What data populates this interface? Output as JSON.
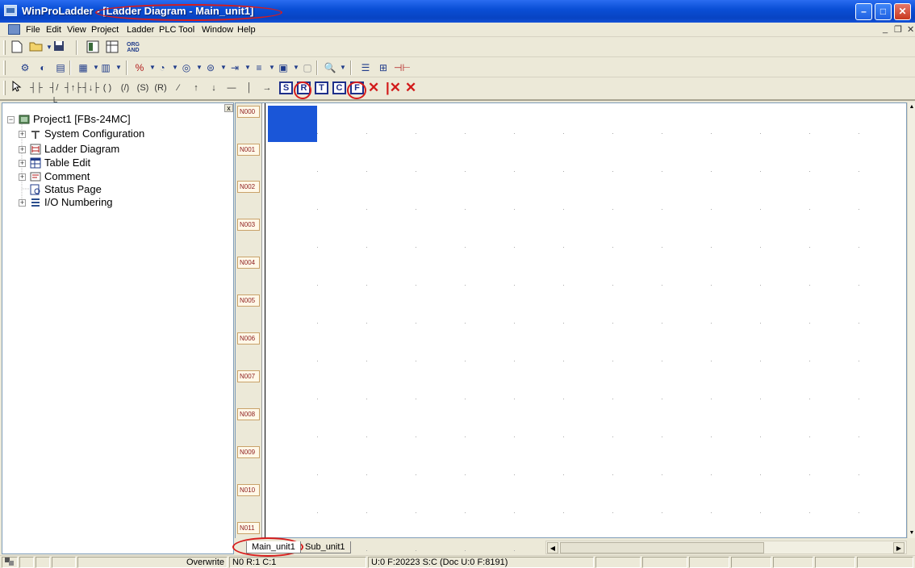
{
  "window": {
    "title_prefix": "WinProLadder",
    "title_sep": " - ",
    "title_doc": "[Ladder Diagram - Main_unit1]",
    "min_glyph": "–",
    "max_glyph": "□",
    "close_glyph": "✕"
  },
  "menu": {
    "items": [
      "File",
      "Edit",
      "View",
      "Project",
      "Ladder",
      "PLC",
      "Tool",
      "Window",
      "Help"
    ],
    "mdi_min": "_",
    "mdi_restore": "❐",
    "mdi_close": "✕"
  },
  "toolbar1": {
    "org_and_top": "ORG",
    "org_and_bottom": "AND"
  },
  "ladder_toolbar": {
    "box_labels": [
      "S",
      "R",
      "T",
      "C",
      "F"
    ],
    "delete_glyphs": [
      "✕",
      "|✕",
      "✕"
    ]
  },
  "tree": {
    "root": "Project1 [FBs-24MC]",
    "items": [
      "System Configuration",
      "Ladder Diagram",
      "Table Edit",
      "Comment",
      "Status Page",
      "I/O Numbering"
    ],
    "close_glyph": "x"
  },
  "editor": {
    "networks": [
      "N000",
      "N001",
      "N002",
      "N003",
      "N004",
      "N005",
      "N006",
      "N007",
      "N008",
      "N009",
      "N010",
      "N011"
    ]
  },
  "tabs": {
    "active": "Main_unit1",
    "other": "Sub_unit1"
  },
  "status": {
    "mode": "Overwrite",
    "position": "N0 R:1 C:1",
    "memory": "U:0 F:20223 S:C (Doc U:0 F:8191)"
  },
  "colors": {
    "title_bar": "#0a4fd6",
    "selection": "#1a56d8",
    "annotation": "#d71c1c"
  }
}
